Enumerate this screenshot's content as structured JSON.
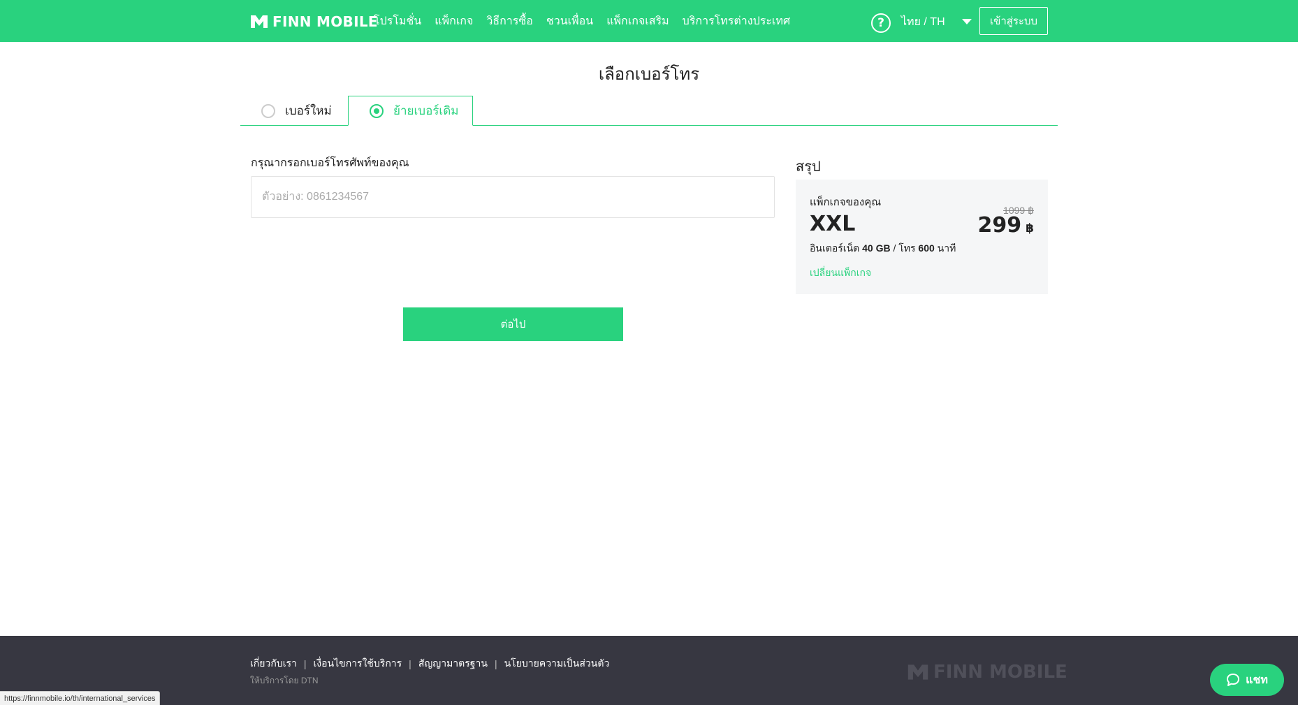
{
  "header": {
    "brand": "FINN MOBILE",
    "nav": [
      "โปรโมชั่น",
      "แพ็กเกจ",
      "วิธีการซื้อ",
      "ชวนเพื่อน",
      "แพ็กเกจเสริม",
      "บริการโทรต่างประเทศ"
    ],
    "help_glyph": "?",
    "language": "ไทย / TH",
    "login_label": "เข้าสู่ระบบ"
  },
  "page": {
    "title": "เลือกเบอร์โทร",
    "tabs": [
      {
        "label": "เบอร์ใหม่",
        "selected": false
      },
      {
        "label": "ย้ายเบอร์เดิม",
        "selected": true
      }
    ],
    "phone_label": "กรุณากรอกเบอร์โทรศัพท์ของคุณ",
    "phone_value": "",
    "phone_placeholder": "ตัวอย่าง: 0861234567",
    "next_label": "ต่อไป"
  },
  "summary": {
    "title": "สรุป",
    "package_label": "แพ็กเกจของคุณ",
    "package_name": "XXL",
    "old_price": "1099 ฿",
    "price": "299",
    "currency": "฿",
    "detail_prefix": "อินเตอร์เน็ต ",
    "data_amount": "40 GB",
    "detail_mid": " / โทร ",
    "call_amount": "600",
    "detail_suffix": " นาที",
    "change_label": "เปลี่ยนแพ็กเกจ"
  },
  "footer": {
    "links": [
      "เกี่ยวกับเรา",
      "เงื่อนไขการใช้บริการ",
      "สัญญามาตรฐาน",
      "นโยบายความเป็นส่วนตัว"
    ],
    "separator": "|",
    "provider": "ให้บริการโดย DTN",
    "brand": "FINN MOBILE"
  },
  "chat": {
    "label": "แชท"
  },
  "status_bar": {
    "url": "https://finnmobile.io/th/international_services"
  },
  "colors": {
    "brand_green": "#29d27e",
    "footer_bg": "#373741"
  },
  "icons": {
    "logo": "finn-logo-icon",
    "help": "help-icon",
    "caret": "caret-down-icon",
    "chat": "chat-bubble-icon"
  }
}
